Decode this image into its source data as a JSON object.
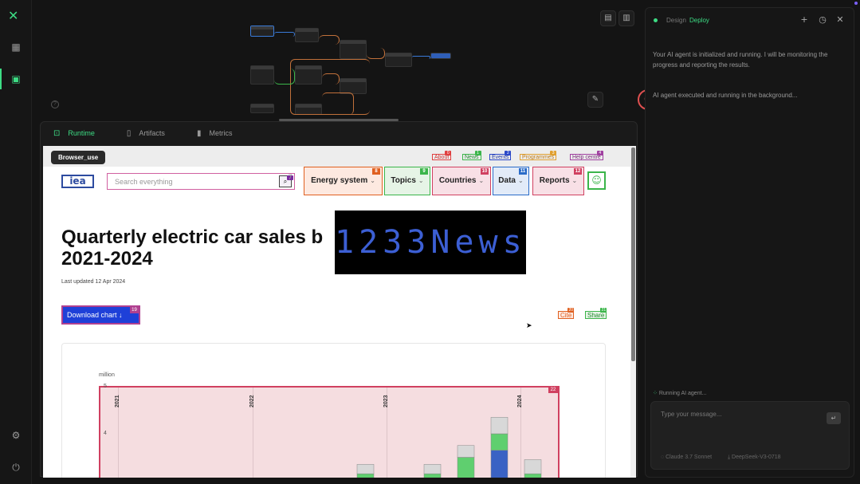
{
  "left_rail": {
    "logo_icon": "xe-logo-icon",
    "items": [
      "dashboard-grid-icon",
      "workflow-icon"
    ],
    "bottom": [
      "settings-icon",
      "logout-icon"
    ]
  },
  "canvas": {
    "toolbar_icons": [
      "save-icon",
      "layout-icon"
    ],
    "tool_icons": [
      "wrench-icon",
      "stop-icon"
    ],
    "help_label": "?",
    "stop_glyph": "⊘"
  },
  "panel": {
    "tabs": [
      {
        "label": "Runtime",
        "icon": "terminal-icon",
        "active": true
      },
      {
        "label": "Artifacts",
        "icon": "document-icon",
        "active": false
      },
      {
        "label": "Metrics",
        "icon": "bar-chart-icon",
        "active": false
      }
    ]
  },
  "browser": {
    "label": "Browser_use",
    "top_links": [
      {
        "label": "About",
        "badge": "0",
        "color": "#e04040",
        "text_color": "#d03030"
      },
      {
        "label": "News",
        "badge": "1",
        "color": "#3bb54a",
        "text_color": "#1f8a2e"
      },
      {
        "label": "Events",
        "badge": "2",
        "color": "#2b48c8",
        "text_color": "#1e36a6"
      },
      {
        "label": "Programmes",
        "badge": "3",
        "color": "#e0a030",
        "text_color": "#c07a10"
      },
      {
        "label": "Help centre",
        "badge": "4",
        "color": "#a040a0",
        "text_color": "#7a2a7a"
      }
    ],
    "logo_text": "iea",
    "search_placeholder": "Search everything",
    "search_badge": "7",
    "nav": [
      {
        "label": "Energy system",
        "badge": "8",
        "color": "#e06020",
        "bg": "#fde9e0"
      },
      {
        "label": "Topics",
        "badge": "9",
        "color": "#3bb54a",
        "bg": "#e6f4e6"
      },
      {
        "label": "Countries",
        "badge": "10",
        "color": "#d04060",
        "bg": "#f8e0e6"
      },
      {
        "label": "Data",
        "badge": "11",
        "color": "#2b6cc8",
        "bg": "#e2ebf8"
      },
      {
        "label": "Reports",
        "badge": "12",
        "color": "#d04060",
        "bg": "#f8e0e6"
      }
    ],
    "user_icon": "user-icon",
    "page_title": "Quarterly electric car sales b… 2021-2024",
    "title_line1": "Quarterly electric car sales b",
    "title_line2": "2021-2024",
    "last_updated": "Last updated 12 Apr 2024",
    "overlay_text": "1233News",
    "download_label": "Download chart ↓",
    "download_badge": "19",
    "cite_label": "Cite",
    "cite_badge": "20",
    "share_label": "Share",
    "share_badge": "21"
  },
  "chart_data": {
    "type": "bar",
    "ylabel": "million",
    "ylim": [
      3,
      5
    ],
    "yticks": [
      "5",
      "4",
      "3"
    ],
    "year_labels": [
      "2021",
      "2022",
      "2023",
      "2024"
    ],
    "plot_badge": "22",
    "stacked_bars": [
      {
        "top_segment": 3.35,
        "mid_segment": 3.15,
        "bottom": 3.0
      },
      {
        "top_segment": 3.35,
        "mid_segment": 3.15,
        "bottom": 3.0
      },
      {
        "top_segment": 3.75,
        "mid_segment": 3.5,
        "bottom": 3.05
      },
      {
        "top_segment": 4.35,
        "mid_segment": 4.0,
        "bottom": 3.65
      },
      {
        "top_segment": 3.45,
        "mid_segment": 3.15,
        "bottom": 3.0
      }
    ],
    "colors": {
      "top": "#d8d8d8",
      "mid": "#5fcf6f",
      "bottom": "#3a62c4"
    }
  },
  "chat": {
    "tab_design": "Design",
    "tab_deploy": "Deploy",
    "head_icons": [
      "plus-icon",
      "history-icon",
      "close-icon"
    ],
    "messages": [
      "Your AI agent is initialized and running. I will be monitoring the progress and reporting the results.",
      "AI agent executed and running in the background..."
    ],
    "status": "Running AI agent...",
    "input_placeholder": "Type your message...",
    "send_glyph": "↵",
    "models": [
      "Claude 3.7 Sonnet",
      "DeepSeek-V3-0718"
    ]
  }
}
